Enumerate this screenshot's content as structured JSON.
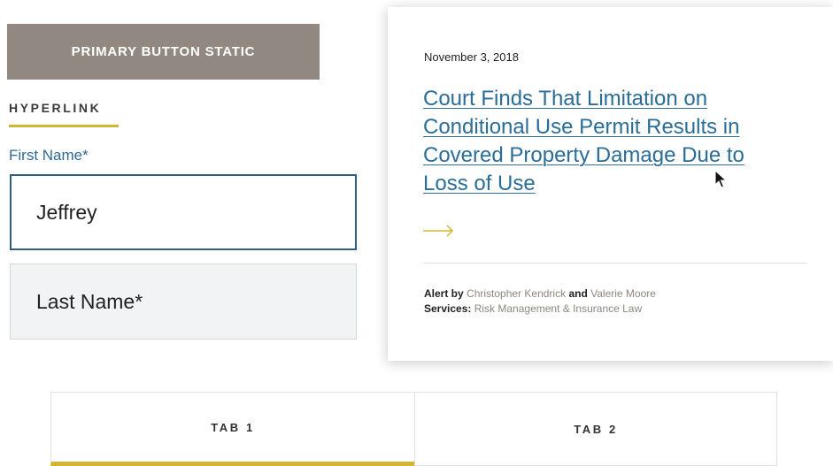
{
  "buttons": {
    "primary_label": "PRIMARY BUTTON STATIC"
  },
  "hyperlink": {
    "label": "HYPERLINK"
  },
  "form": {
    "first_name": {
      "label": "First Name*",
      "value": "Jeffrey"
    },
    "last_name": {
      "placeholder": "Last Name*"
    }
  },
  "article": {
    "date": "November 3, 2018",
    "title": "Court Finds That Limitation on Conditional Use Permit Results in Covered Property Damage Due to Loss of Use",
    "arrow_icon": "arrow-right-icon",
    "alert_prefix": "Alert by",
    "authors": [
      "Christopher Kendrick",
      "Valerie Moore"
    ],
    "author_joiner": "and",
    "services_label": "Services:",
    "services": "Risk Management & Insurance Law"
  },
  "tabs": [
    {
      "label": "TAB 1",
      "active": true
    },
    {
      "label": "TAB 2",
      "active": false
    }
  ],
  "colors": {
    "button_bg": "#918981",
    "accent_gold": "#d2b531",
    "link_blue": "#2b6d99",
    "muted_link": "#8e8780"
  }
}
